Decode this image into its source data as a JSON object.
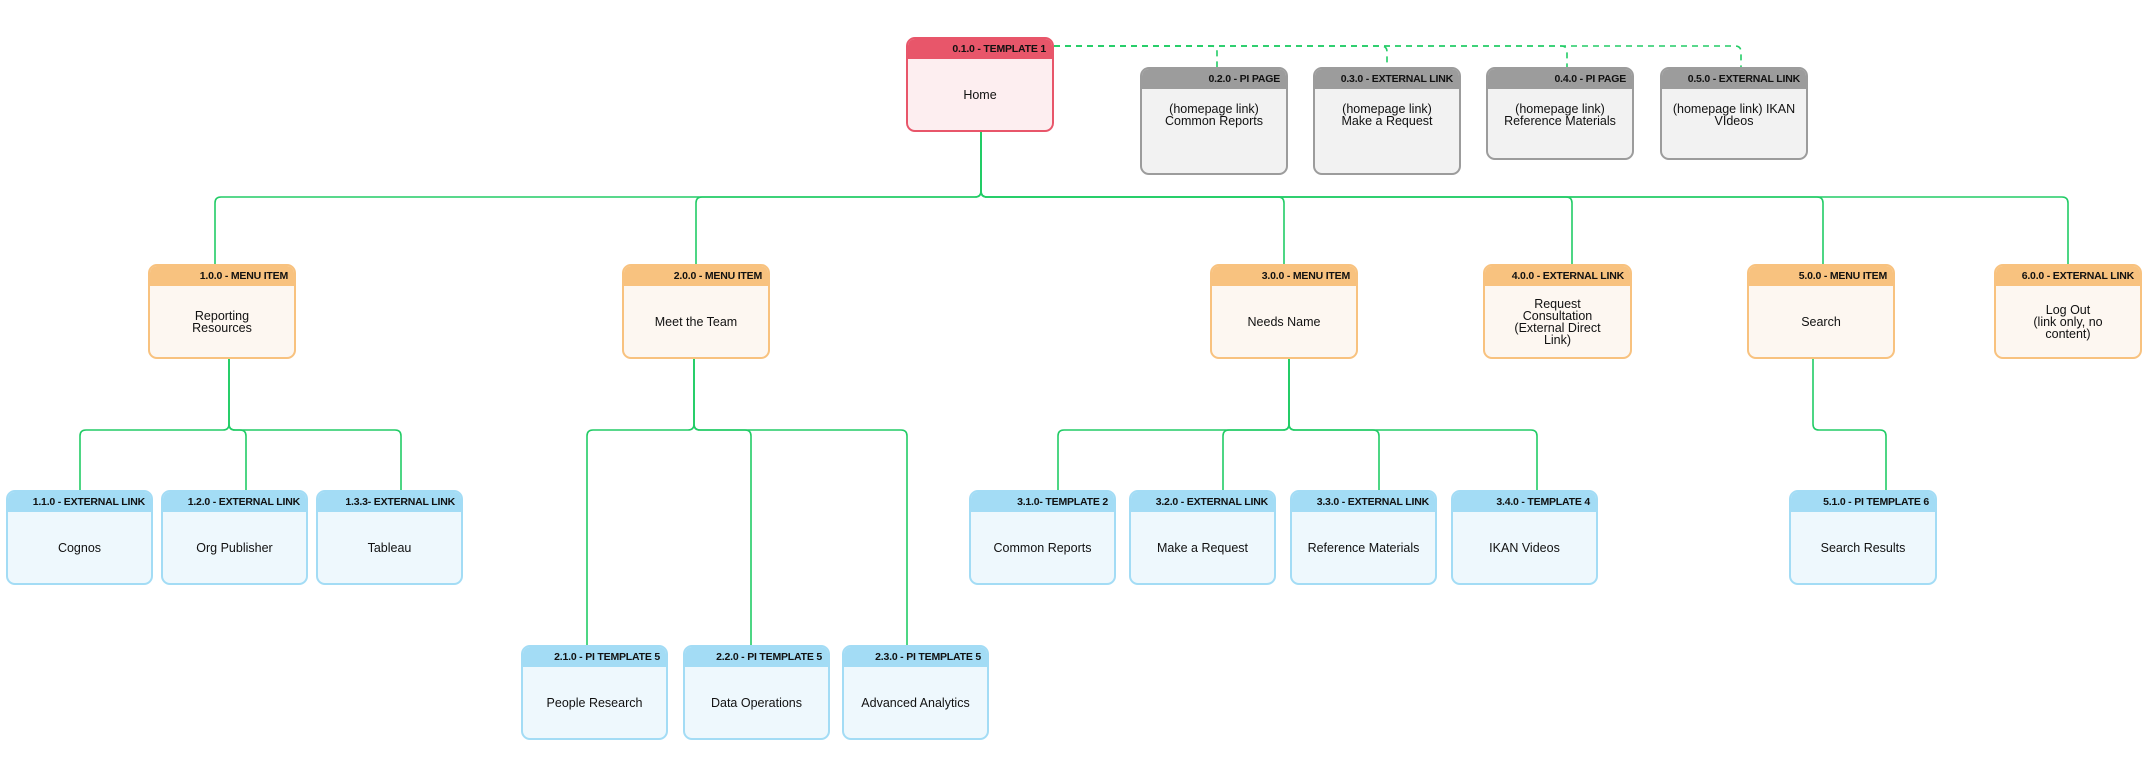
{
  "diagram": {
    "type": "sitemap",
    "colors": {
      "connector": "#22cc66",
      "template_header": "#e8566a",
      "menu_header": "#f8c27f",
      "child_header": "#a3dcf5",
      "homepage_link_header": "#9c9c9c"
    },
    "nodes": [
      {
        "id": "0.1.0",
        "header": "0.1.0 - TEMPLATE 1",
        "label": "Home",
        "style": "red",
        "parent": null
      },
      {
        "id": "0.2.0",
        "header": "0.2.0 - PI PAGE",
        "label": "(homepage link)\nCommon Reports",
        "style": "gray",
        "parent": "0.1.0",
        "link": "dashed"
      },
      {
        "id": "0.3.0",
        "header": "0.3.0 - EXTERNAL LINK",
        "label": "(homepage link)\nMake a Request",
        "style": "gray",
        "parent": "0.1.0",
        "link": "dashed"
      },
      {
        "id": "0.4.0",
        "header": "0.4.0 - PI PAGE",
        "label": "(homepage link)\nReference Materials",
        "style": "gray",
        "parent": "0.1.0",
        "link": "dashed"
      },
      {
        "id": "0.5.0",
        "header": "0.5.0 - EXTERNAL LINK",
        "label": "(homepage link) IKAN\nVIdeos",
        "style": "gray",
        "parent": "0.1.0",
        "link": "dashed"
      },
      {
        "id": "1.0.0",
        "header": "1.0.0 - MENU ITEM",
        "label": "Reporting\nResources",
        "style": "orange",
        "parent": "0.1.0"
      },
      {
        "id": "1.1.0",
        "header": "1.1.0 - EXTERNAL LINK",
        "label": "Cognos",
        "style": "blue",
        "parent": "1.0.0"
      },
      {
        "id": "1.2.0",
        "header": "1.2.0 - EXTERNAL LINK",
        "label": "Org Publisher",
        "style": "blue",
        "parent": "1.0.0"
      },
      {
        "id": "1.3.3",
        "header": "1.3.3- EXTERNAL LINK",
        "label": "Tableau",
        "style": "blue",
        "parent": "1.0.0"
      },
      {
        "id": "2.0.0",
        "header": "2.0.0 - MENU ITEM",
        "label": "Meet the Team",
        "style": "orange",
        "parent": "0.1.0"
      },
      {
        "id": "2.1.0",
        "header": "2.1.0 - PI TEMPLATE 5",
        "label": "People Research",
        "style": "blue",
        "parent": "2.0.0"
      },
      {
        "id": "2.2.0",
        "header": "2.2.0 - PI TEMPLATE 5",
        "label": "Data Operations",
        "style": "blue",
        "parent": "2.0.0"
      },
      {
        "id": "2.3.0",
        "header": "2.3.0 - PI TEMPLATE 5",
        "label": "Advanced Analytics",
        "style": "blue",
        "parent": "2.0.0"
      },
      {
        "id": "3.0.0",
        "header": "3.0.0 - MENU ITEM",
        "label": "Needs Name",
        "style": "orange",
        "parent": "0.1.0"
      },
      {
        "id": "3.1.0",
        "header": "3.1.0- TEMPLATE 2",
        "label": "Common Reports",
        "style": "blue",
        "parent": "3.0.0"
      },
      {
        "id": "3.2.0",
        "header": "3.2.0 - EXTERNAL LINK",
        "label": "Make a Request",
        "style": "blue",
        "parent": "3.0.0"
      },
      {
        "id": "3.3.0",
        "header": "3.3.0 - EXTERNAL LINK",
        "label": "Reference Materials",
        "style": "blue",
        "parent": "3.0.0"
      },
      {
        "id": "3.4.0",
        "header": "3.4.0 - TEMPLATE 4",
        "label": "IKAN Videos",
        "style": "blue",
        "parent": "3.0.0"
      },
      {
        "id": "4.0.0",
        "header": "4.0.0 - EXTERNAL LINK",
        "label": "Request\nConsultation\n(External Direct\nLink)",
        "style": "orange",
        "parent": "0.1.0"
      },
      {
        "id": "5.0.0",
        "header": "5.0.0 - MENU ITEM",
        "label": "Search",
        "style": "orange",
        "parent": "0.1.0"
      },
      {
        "id": "5.1.0",
        "header": "5.1.0 - PI TEMPLATE 6",
        "label": "Search Results",
        "style": "blue",
        "parent": "5.0.0"
      },
      {
        "id": "6.0.0",
        "header": "6.0.0 - EXTERNAL LINK",
        "label": "Log Out\n(link only, no\ncontent)",
        "style": "orange",
        "parent": "0.1.0"
      }
    ]
  }
}
